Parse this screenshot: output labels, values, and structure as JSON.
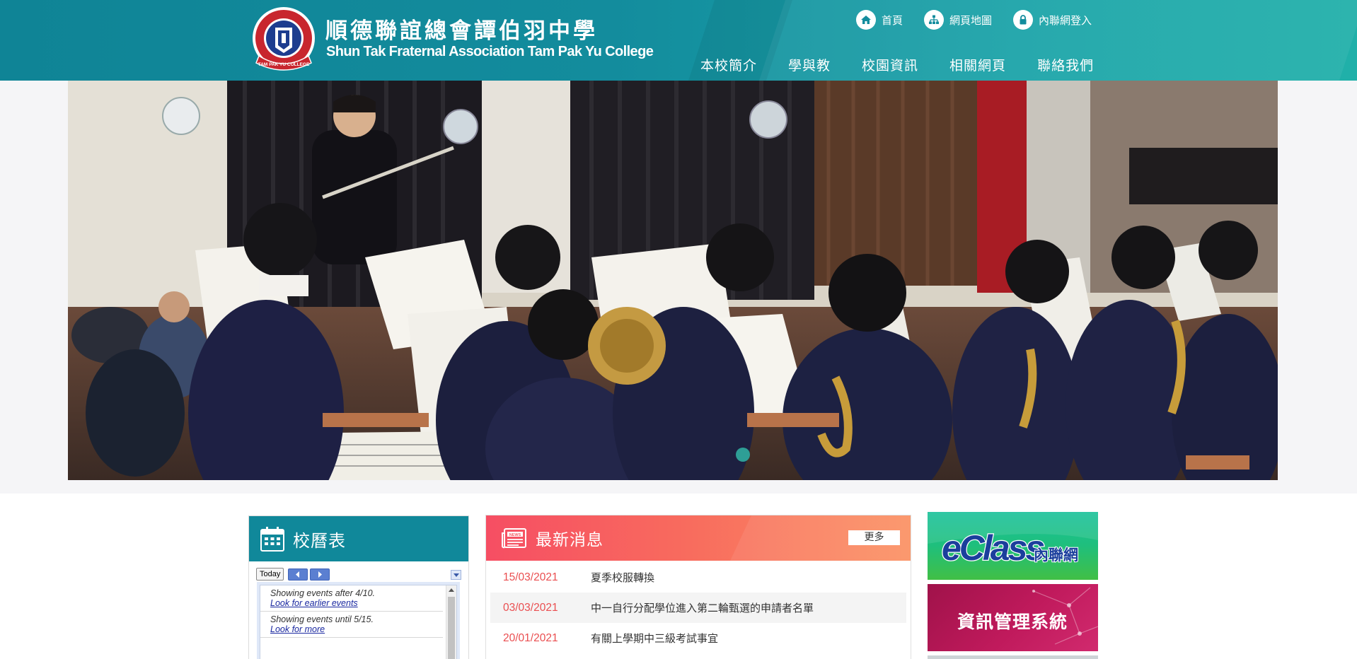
{
  "header": {
    "school_name_cn": "順德聯誼總會譚伯羽中學",
    "school_name_en": "Shun Tak Fraternal Association Tam Pak Yu College",
    "logo_text": "TAM PAK YU COLLEGE",
    "top_links": [
      {
        "label": "首頁",
        "icon": "home-icon"
      },
      {
        "label": "網頁地圖",
        "icon": "sitemap-icon"
      },
      {
        "label": "內聯網登入",
        "icon": "lock-icon"
      }
    ],
    "nav": [
      "本校簡介",
      "學與教",
      "校園資訊",
      "相關網頁",
      "聯絡我們"
    ]
  },
  "hero": {
    "slide_count": 1,
    "active_slide": 1
  },
  "calendar": {
    "title": "校曆表",
    "today_label": "Today",
    "entries": [
      {
        "text": "Showing events after 4/10.",
        "link": "Look for earlier events"
      },
      {
        "text": "Showing events until 5/15.",
        "link": "Look for more"
      }
    ]
  },
  "news": {
    "title": "最新消息",
    "more_label": "更多",
    "items": [
      {
        "date": "15/03/2021",
        "title": "夏季校服轉換"
      },
      {
        "date": "03/03/2021",
        "title": "中一自行分配學位進入第二輪甄選的申請者名單"
      },
      {
        "date": "20/01/2021",
        "title": "有關上學期中三級考試事宜"
      }
    ]
  },
  "banners": {
    "eclass_main": "eClass",
    "eclass_sub": "內聯網",
    "ims": "資訊管理系統"
  },
  "colors": {
    "header_teal": "#10889a",
    "news_red": "#f64e63",
    "news_date": "#ea4e50",
    "eclass_green": "#1fbf7c",
    "ims_magenta": "#b0154f"
  }
}
